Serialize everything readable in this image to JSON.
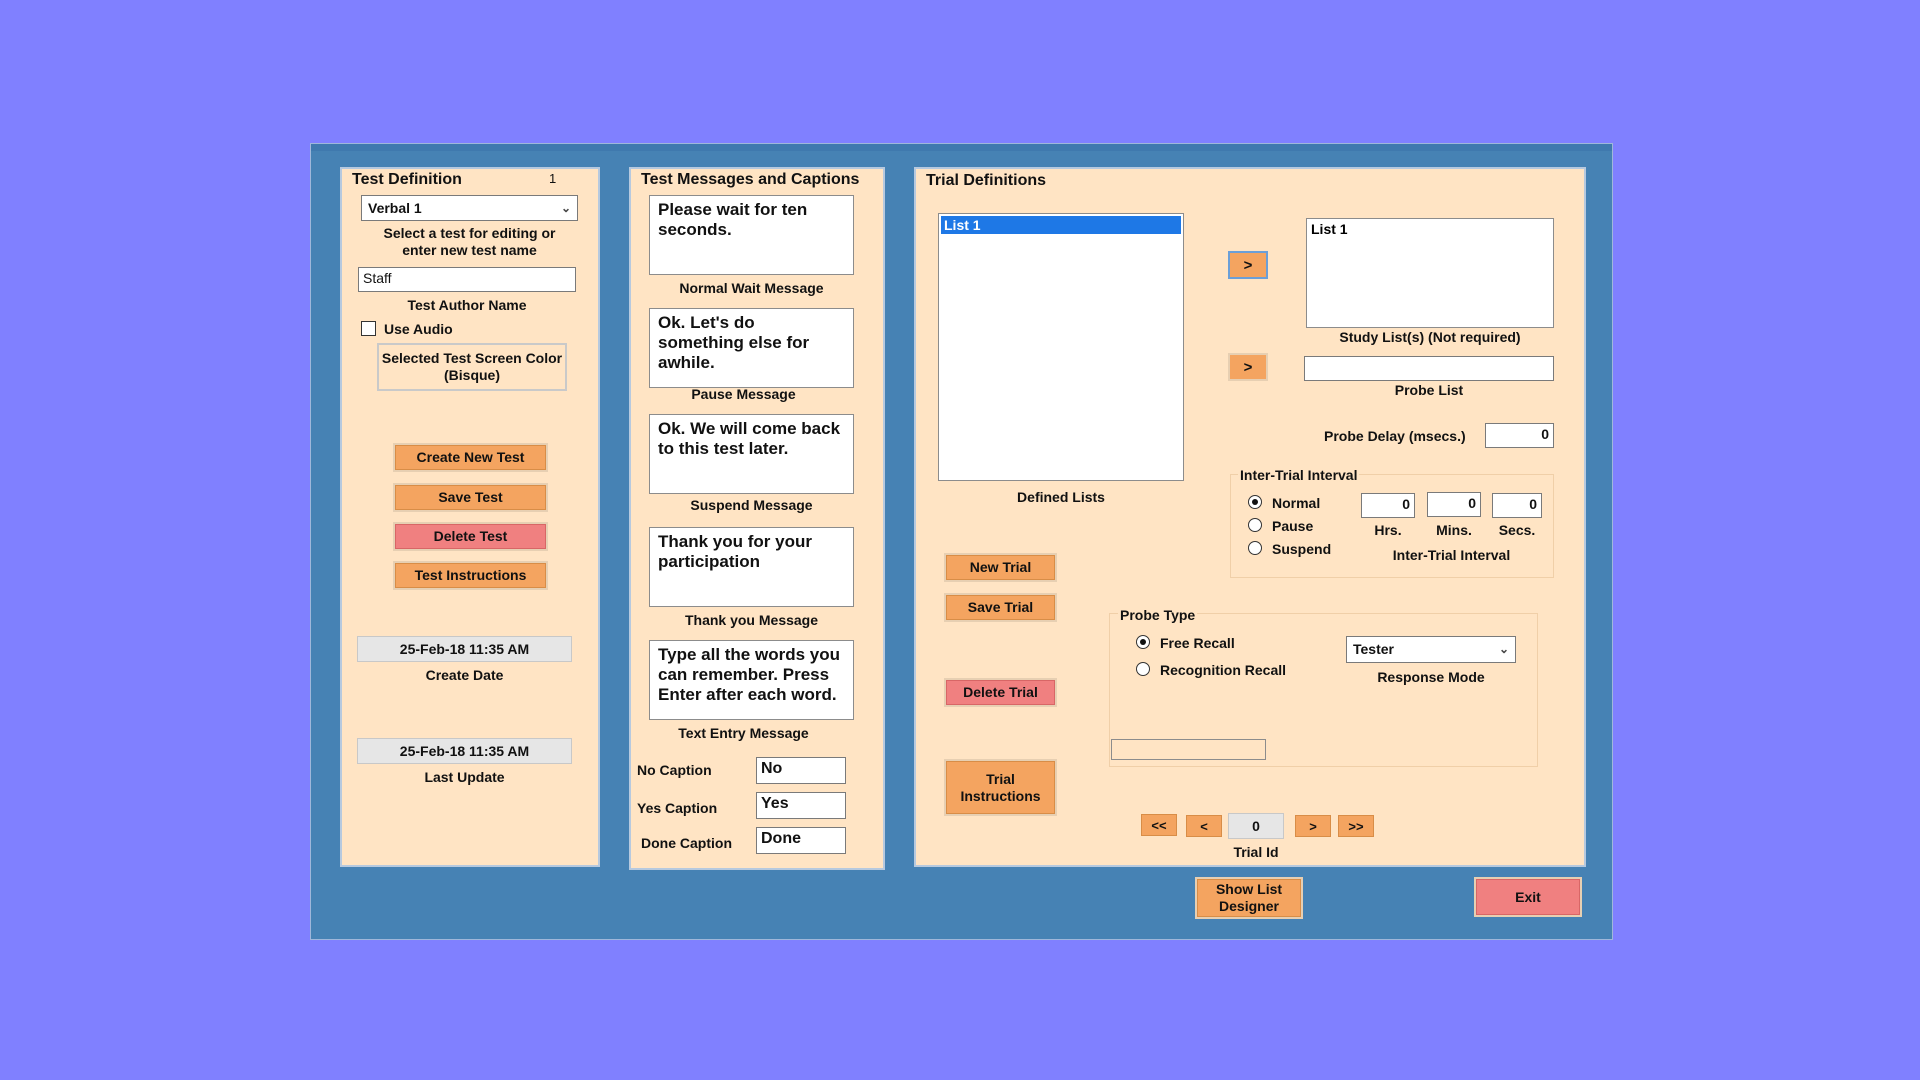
{
  "test_definition": {
    "title": "Test Definition",
    "test_number": "1",
    "selected_test": "Verbal 1",
    "select_hint": "Select a test for editing or enter new test name",
    "author_value": "Staff",
    "author_label": "Test Author Name",
    "use_audio_label": "Use Audio",
    "use_audio_checked": false,
    "screen_color_label": "Selected Test Screen Color (Bisque)",
    "create_new_test": "Create New Test",
    "save_test": "Save Test",
    "delete_test": "Delete Test",
    "test_instructions": "Test Instructions",
    "create_date_value": "25-Feb-18 11:35 AM",
    "create_date_label": "Create Date",
    "last_update_value": "25-Feb-18 11:35 AM",
    "last_update_label": "Last Update"
  },
  "messages": {
    "title": "Test Messages and Captions",
    "normal_wait_text": "Please wait for ten seconds.",
    "normal_wait_label": "Normal Wait Message",
    "pause_text": "Ok. Let's do something else for awhile.",
    "pause_label": "Pause Message",
    "suspend_text": "Ok. We will come back to this test later.",
    "suspend_label": "Suspend Message",
    "thankyou_text": "Thank you for your participation",
    "thankyou_label": "Thank you Message",
    "text_entry_text": "Type all the words you can remember. Press Enter after each word.",
    "text_entry_label": "Text Entry Message",
    "no_caption_label": "No Caption",
    "no_caption_value": "No",
    "yes_caption_label": "Yes Caption",
    "yes_caption_value": "Yes",
    "done_caption_label": "Done Caption",
    "done_caption_value": "Done"
  },
  "trials": {
    "title": "Trial Definitions",
    "defined_lists": [
      "List 1"
    ],
    "defined_lists_label": "Defined Lists",
    "arrow": ">",
    "study_lists": [
      "List 1"
    ],
    "study_list_label": "Study List(s) (Not required)",
    "probe_list_value": "",
    "probe_list_label": "Probe List",
    "probe_delay_label": "Probe Delay (msecs.)",
    "probe_delay_value": "0",
    "iti_group_title": "Inter-Trial Interval",
    "iti_options": [
      "Normal",
      "Pause",
      "Suspend"
    ],
    "iti_selected": "Normal",
    "hrs_value": "0",
    "mins_value": "0",
    "secs_value": "0",
    "hrs_label": "Hrs.",
    "mins_label": "Mins.",
    "secs_label": "Secs.",
    "iti_caption": "Inter-Trial Interval",
    "new_trial": "New Trial",
    "save_trial": "Save Trial",
    "delete_trial": "Delete Trial",
    "trial_instructions": "Trial Instructions",
    "probe_type_title": "Probe Type",
    "probe_options": [
      "Free Recall",
      "Recognition Recall"
    ],
    "probe_selected": "Free Recall",
    "response_mode_value": "Tester",
    "response_mode_label": "Response Mode",
    "nav_first": "<<",
    "nav_prev": "<",
    "trial_id_value": "0",
    "nav_next": ">",
    "nav_last": ">>",
    "trial_id_label": "Trial Id"
  },
  "footer": {
    "show_list_designer": "Show List Designer",
    "exit": "Exit"
  },
  "colors": {
    "background": "#8080ff",
    "window": "#4682b4",
    "panel": "#ffe4c4",
    "button": "#f4a460",
    "danger_button": "#f08080",
    "selection": "#1e78e6"
  }
}
